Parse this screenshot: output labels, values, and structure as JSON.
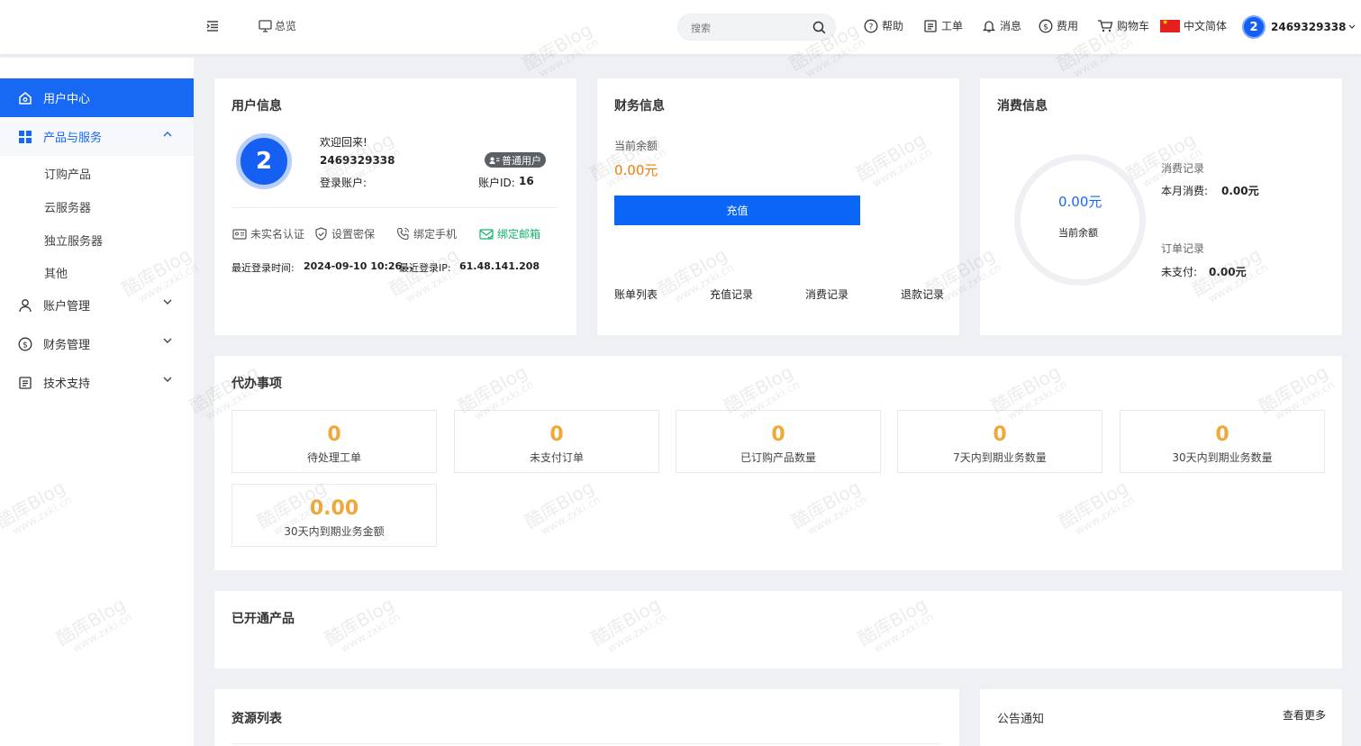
{
  "topbar": {
    "overview_label": "总览",
    "search_placeholder": "搜索",
    "nav": {
      "help": "帮助",
      "ticket": "工单",
      "message": "消息",
      "cost": "费用",
      "cart": "购物车",
      "language": "中文简体"
    },
    "user": {
      "avatar_text": "2",
      "name": "2469329338"
    }
  },
  "sidebar": {
    "items": [
      {
        "label": "用户中心",
        "icon": "home-icon",
        "active": true
      },
      {
        "label": "产品与服务",
        "icon": "grid-icon",
        "expanded": true
      },
      {
        "label": "账户管理",
        "icon": "user-icon"
      },
      {
        "label": "财务管理",
        "icon": "dollar-icon"
      },
      {
        "label": "技术支持",
        "icon": "document-icon"
      }
    ],
    "sub_items": [
      "订购产品",
      "云服务器",
      "独立服务器",
      "其他"
    ]
  },
  "user_info": {
    "title": "用户信息",
    "avatar_text": "2",
    "welcome": "欢迎回来!",
    "account_name": "2469329338",
    "login_account_label": "登录账户:",
    "badge": "普通用户",
    "account_id_label": "账户ID:",
    "account_id": "16",
    "verify": {
      "realname": "未实名认证",
      "security": "设置密保",
      "phone": "绑定手机",
      "email": "绑定邮箱"
    },
    "last_login_time_label": "最近登录时间:",
    "last_login_time": "2024-09-10 10:26...",
    "last_login_ip_label": "最近登录IP:",
    "last_login_ip": "61.48.141.208"
  },
  "finance": {
    "title": "财务信息",
    "balance_label": "当前余额",
    "balance": "0.00元",
    "recharge_button": "充值",
    "links": [
      "账单列表",
      "充值记录",
      "消费记录",
      "退款记录"
    ]
  },
  "consumption": {
    "title": "消费信息",
    "ring_value": "0.00元",
    "ring_label": "当前余额",
    "consume_record_label": "消费记录",
    "month_consume_label": "本月消费:",
    "month_consume": "0.00元",
    "order_record_label": "订单记录",
    "unpaid_label": "未支付:",
    "unpaid": "0.00元"
  },
  "todo": {
    "title": "代办事项",
    "stats": [
      {
        "value": "0",
        "label": "待处理工单"
      },
      {
        "value": "0",
        "label": "未支付订单"
      },
      {
        "value": "0",
        "label": "已订购产品数量"
      },
      {
        "value": "0",
        "label": "7天内到期业务数量"
      },
      {
        "value": "0",
        "label": "30天内到期业务数量"
      },
      {
        "value": "0.00",
        "label": "30天内到期业务金额"
      }
    ]
  },
  "opened_products": {
    "title": "已开通产品"
  },
  "resources": {
    "title": "资源列表"
  },
  "notice": {
    "title": "公告通知",
    "more": "查看更多"
  },
  "watermark": {
    "brand": "酷库Blog",
    "url": "www.zxki.cn"
  },
  "colors": {
    "primary": "#1769f3",
    "accent_orange": "#f57c00",
    "stat_orange": "#f0a83b",
    "verified_green": "#14b36b"
  }
}
